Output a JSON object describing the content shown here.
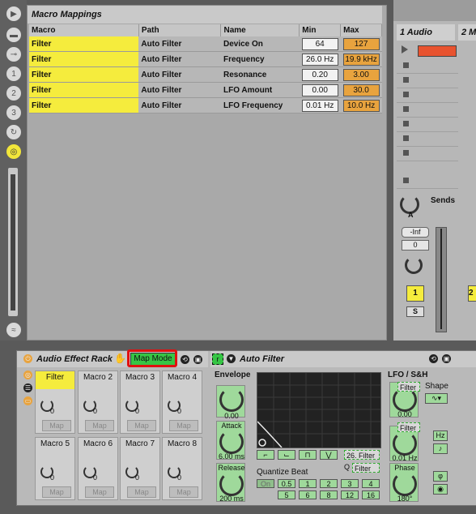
{
  "macro_mappings": {
    "title": "Macro Mappings",
    "columns": [
      "Macro",
      "Path",
      "Name",
      "Min",
      "Max"
    ],
    "rows": [
      {
        "macro": "Filter",
        "path": "Auto Filter",
        "name": "Device On",
        "min": "64",
        "max": "127"
      },
      {
        "macro": "Filter",
        "path": "Auto Filter",
        "name": "Frequency",
        "min": "26.0 Hz",
        "max": "19.9 kHz"
      },
      {
        "macro": "Filter",
        "path": "Auto Filter",
        "name": "Resonance",
        "min": "0.20",
        "max": "3.00"
      },
      {
        "macro": "Filter",
        "path": "Auto Filter",
        "name": "LFO Amount",
        "min": "0.00",
        "max": "30.0"
      },
      {
        "macro": "Filter",
        "path": "Auto Filter",
        "name": "LFO Frequency",
        "min": "0.01 Hz",
        "max": "10.0 Hz"
      }
    ]
  },
  "mixer": {
    "track1": "1 Audio",
    "track2": "2 M",
    "sends": "Sends",
    "send_label": "A",
    "volume": "-Inf",
    "pan": "0",
    "track_number": "1",
    "track_number2": "2",
    "solo": "S"
  },
  "rack": {
    "title": "Audio Effect Rack",
    "map_mode": "Map Mode",
    "macros": [
      {
        "label": "Filter",
        "value": "0",
        "map": "Map"
      },
      {
        "label": "Macro  2",
        "value": "0",
        "map": "Map"
      },
      {
        "label": "Macro  3",
        "value": "0",
        "map": "Map"
      },
      {
        "label": "Macro  4",
        "value": "0",
        "map": "Map"
      },
      {
        "label": "Macro  5",
        "value": "0",
        "map": "Map"
      },
      {
        "label": "Macro  6",
        "value": "0",
        "map": "Map"
      },
      {
        "label": "Macro  7",
        "value": "0",
        "map": "Map"
      },
      {
        "label": "Macro  8",
        "value": "0",
        "map": "Map"
      }
    ]
  },
  "auto_filter": {
    "title": "Auto Filter",
    "toggle": "r",
    "envelope": "Envelope",
    "env_value": "0.00",
    "attack_label": "Attack",
    "attack_value": "6.00 ms",
    "release_label": "Release",
    "release_value": "200 ms",
    "lfo_label": "LFO / S&H",
    "lfo_amount_value": "0.00",
    "lfo_freq_value": "0.01 Hz",
    "phase_label": "Phase",
    "phase_value": "180°",
    "shape_label": "Shape",
    "hz_label": "Hz",
    "note_icon": "♪",
    "phi_icon": "φ",
    "filter_tag": "Filter",
    "freq_value": "26.",
    "q_label": "Q",
    "quantize_label": "Quantize Beat",
    "quantize_options": [
      "On",
      "0.5",
      "1",
      "2",
      "3",
      "4",
      "5",
      "6",
      "8",
      "12",
      "16"
    ]
  }
}
